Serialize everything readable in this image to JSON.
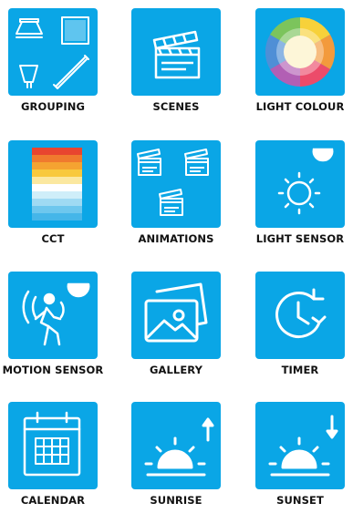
{
  "tiles": [
    {
      "label": "GROUPING",
      "icon": "grouping-icon"
    },
    {
      "label": "SCENES",
      "icon": "clapperboard-icon"
    },
    {
      "label": "LIGHT COLOUR",
      "icon": "color-wheel-icon"
    },
    {
      "label": "CCT",
      "icon": "color-temperature-icon"
    },
    {
      "label": "ANIMATIONS",
      "icon": "clapperboards-icon"
    },
    {
      "label": "LIGHT SENSOR",
      "icon": "sun-sensor-icon"
    },
    {
      "label": "MOTION SENSOR",
      "icon": "motion-sensor-icon"
    },
    {
      "label": "GALLERY",
      "icon": "gallery-icon"
    },
    {
      "label": "TIMER",
      "icon": "timer-clock-icon"
    },
    {
      "label": "CALENDAR",
      "icon": "calendar-icon"
    },
    {
      "label": "SUNRISE",
      "icon": "sunrise-icon"
    },
    {
      "label": "SUNSET",
      "icon": "sunset-icon"
    }
  ],
  "colors": {
    "tile_background": "#0aa6e6",
    "icon_stroke": "#ffffff",
    "label_text": "#111111"
  }
}
